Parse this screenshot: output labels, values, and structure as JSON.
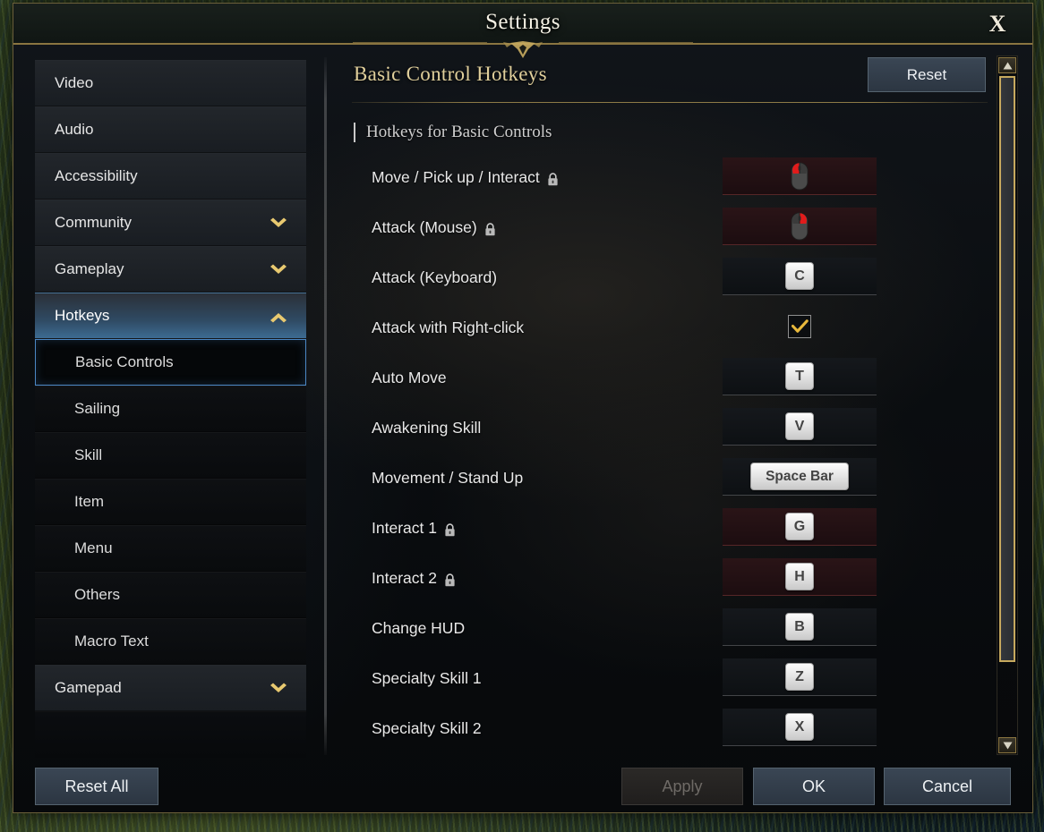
{
  "window": {
    "title": "Settings",
    "close_label": "X"
  },
  "sidebar": {
    "items": [
      {
        "label": "Video",
        "type": "top",
        "state": "normal",
        "chevron": "none"
      },
      {
        "label": "Audio",
        "type": "top",
        "state": "normal",
        "chevron": "none"
      },
      {
        "label": "Accessibility",
        "type": "top",
        "state": "normal",
        "chevron": "none"
      },
      {
        "label": "Community",
        "type": "top",
        "state": "normal",
        "chevron": "chevron-down-icon"
      },
      {
        "label": "Gameplay",
        "type": "top",
        "state": "normal",
        "chevron": "chevron-down-icon"
      },
      {
        "label": "Hotkeys",
        "type": "top",
        "state": "expanded",
        "chevron": "chevron-up-icon"
      },
      {
        "label": "Basic Controls",
        "type": "sub",
        "state": "selected",
        "chevron": "none"
      },
      {
        "label": "Sailing",
        "type": "sub",
        "state": "normal",
        "chevron": "none"
      },
      {
        "label": "Skill",
        "type": "sub",
        "state": "normal",
        "chevron": "none"
      },
      {
        "label": "Item",
        "type": "sub",
        "state": "normal",
        "chevron": "none"
      },
      {
        "label": "Menu",
        "type": "sub",
        "state": "normal",
        "chevron": "none"
      },
      {
        "label": "Others",
        "type": "sub",
        "state": "normal",
        "chevron": "none"
      },
      {
        "label": "Macro Text",
        "type": "sub",
        "state": "normal",
        "chevron": "none"
      },
      {
        "label": "Gamepad",
        "type": "top",
        "state": "normal",
        "chevron": "chevron-down-icon"
      }
    ]
  },
  "content": {
    "title": "Basic Control Hotkeys",
    "reset_label": "Reset",
    "section_title": "Hotkeys for Basic Controls",
    "rows": [
      {
        "label": "Move / Pick up / Interact",
        "locked": true,
        "binding_type": "mouse",
        "binding_value": "mouse-left-icon"
      },
      {
        "label": "Attack (Mouse)",
        "locked": true,
        "binding_type": "mouse",
        "binding_value": "mouse-right-icon"
      },
      {
        "label": "Attack (Keyboard)",
        "locked": false,
        "binding_type": "key",
        "binding_value": "C"
      },
      {
        "label": "Attack with Right-click",
        "locked": false,
        "binding_type": "checkbox",
        "binding_value": "checked"
      },
      {
        "label": "Auto Move",
        "locked": false,
        "binding_type": "key",
        "binding_value": "T"
      },
      {
        "label": "Awakening Skill",
        "locked": false,
        "binding_type": "key",
        "binding_value": "V"
      },
      {
        "label": "Movement / Stand Up",
        "locked": false,
        "binding_type": "key-wide",
        "binding_value": "Space Bar"
      },
      {
        "label": "Interact 1",
        "locked": true,
        "binding_type": "key",
        "binding_value": "G"
      },
      {
        "label": "Interact 2",
        "locked": true,
        "binding_type": "key",
        "binding_value": "H"
      },
      {
        "label": "Change HUD",
        "locked": false,
        "binding_type": "key",
        "binding_value": "B"
      },
      {
        "label": "Specialty Skill 1",
        "locked": false,
        "binding_type": "key",
        "binding_value": "Z"
      },
      {
        "label": "Specialty Skill 2",
        "locked": false,
        "binding_type": "key",
        "binding_value": "X"
      }
    ]
  },
  "scrollbar": {
    "up_icon": "triangle-up-icon",
    "down_icon": "triangle-down-icon"
  },
  "footer": {
    "reset_all_label": "Reset All",
    "apply_label": "Apply",
    "ok_label": "OK",
    "cancel_label": "Cancel",
    "apply_disabled": true
  },
  "colors": {
    "gold": "#c6a95e",
    "title_gold": "#e0cf9b",
    "accent_blue": "#4b87c4",
    "button_blue": "#3a4654",
    "locked_red": "#2a1417"
  }
}
